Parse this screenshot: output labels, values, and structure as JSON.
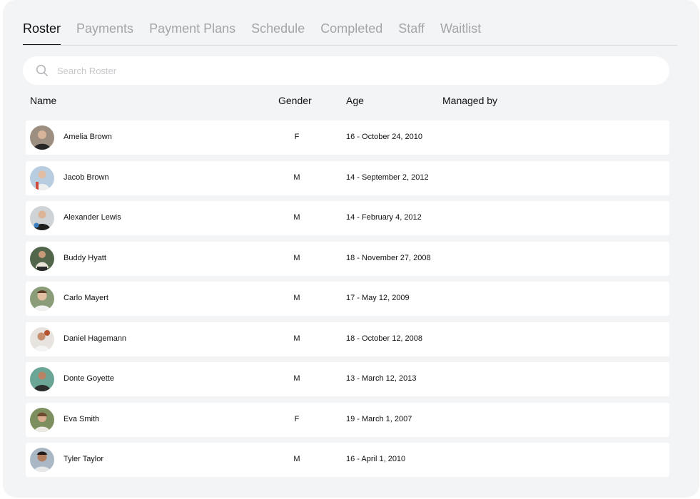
{
  "tabs": [
    {
      "label": "Roster",
      "active": true
    },
    {
      "label": "Payments",
      "active": false
    },
    {
      "label": "Payment Plans",
      "active": false
    },
    {
      "label": "Schedule",
      "active": false
    },
    {
      "label": "Completed",
      "active": false
    },
    {
      "label": "Staff",
      "active": false
    },
    {
      "label": "Waitlist",
      "active": false
    }
  ],
  "search": {
    "placeholder": "Search Roster",
    "value": ""
  },
  "table": {
    "columns": [
      "Name",
      "Gender",
      "Age",
      "Managed by"
    ],
    "rows": [
      {
        "name": "Amelia Brown",
        "gender": "F",
        "age": "16 - October 24, 2010",
        "managed_by": ""
      },
      {
        "name": "Jacob Brown",
        "gender": "M",
        "age": "14 - September 2, 2012",
        "managed_by": ""
      },
      {
        "name": "Alexander Lewis",
        "gender": "M",
        "age": "14 - February 4, 2012",
        "managed_by": ""
      },
      {
        "name": "Buddy Hyatt",
        "gender": "M",
        "age": "18 - November 27, 2008",
        "managed_by": ""
      },
      {
        "name": "Carlo Mayert",
        "gender": "M",
        "age": "17 - May 12, 2009",
        "managed_by": ""
      },
      {
        "name": "Daniel Hagemann",
        "gender": "M",
        "age": "18 - October 12, 2008",
        "managed_by": ""
      },
      {
        "name": "Donte Goyette",
        "gender": "M",
        "age": "13 - March 12, 2013",
        "managed_by": ""
      },
      {
        "name": "Eva Smith",
        "gender": "F",
        "age": "19 - March 1, 2007",
        "managed_by": ""
      },
      {
        "name": "Tyler Taylor",
        "gender": "M",
        "age": "16 - April 1, 2010",
        "managed_by": ""
      }
    ]
  },
  "colors": {
    "panel_bg": "#f3f4f6",
    "active_tab": "#111111",
    "inactive_tab": "#a3a5a8",
    "row_bg": "#ffffff"
  },
  "icons": {
    "search": "search-icon"
  }
}
